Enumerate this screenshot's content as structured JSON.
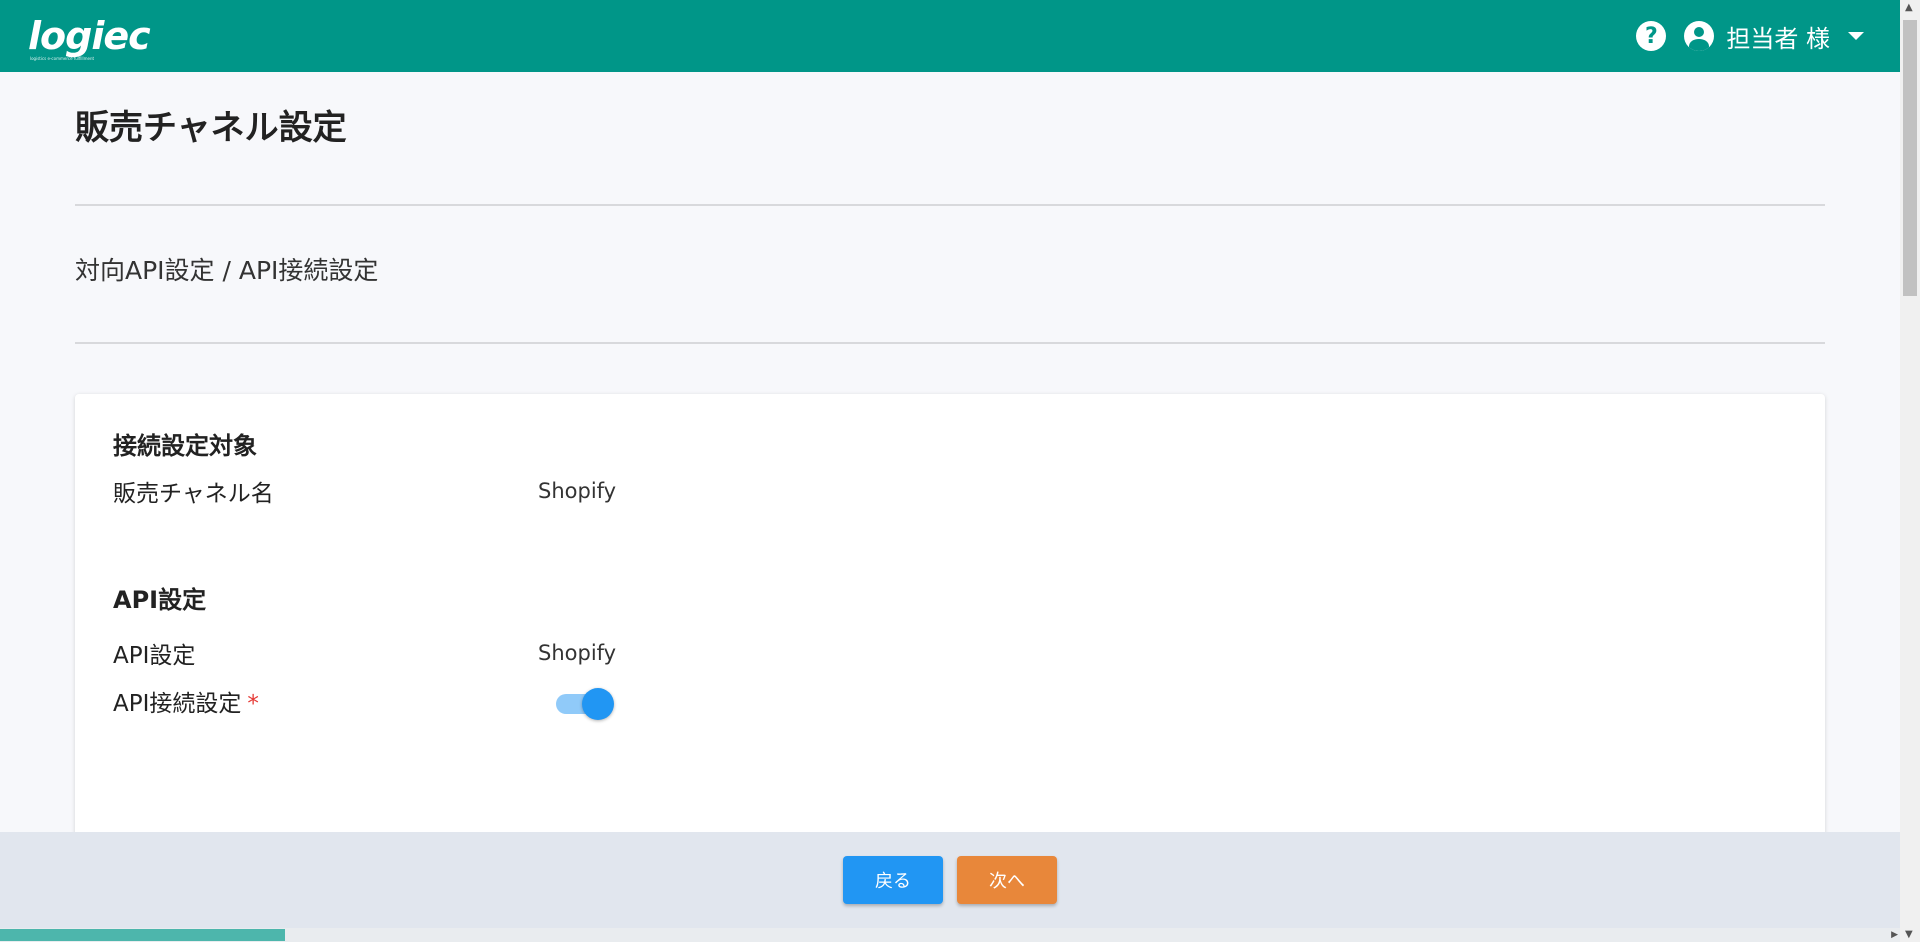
{
  "header": {
    "logo_text": "logiec",
    "logo_tagline": "logistics e-commerce fulfillment",
    "help_icon": "?",
    "user_name": "担当者 様"
  },
  "page": {
    "title": "販売チャネル設定",
    "breadcrumb": "対向API設定 / API接続設定"
  },
  "card": {
    "section1_title": "接続設定対象",
    "channel_name_label": "販売チャネル名",
    "channel_name_value": "Shopify",
    "section2_title": "API設定",
    "api_setting_label": "API設定",
    "api_setting_value": "Shopify",
    "api_connection_label": "API接続設定",
    "required_mark": "*",
    "api_connection_enabled": true
  },
  "footer": {
    "back_label": "戻る",
    "next_label": "次へ"
  },
  "colors": {
    "header": "#009688",
    "primary": "#2196f3",
    "accent": "#e8873a",
    "required": "#e53935"
  }
}
